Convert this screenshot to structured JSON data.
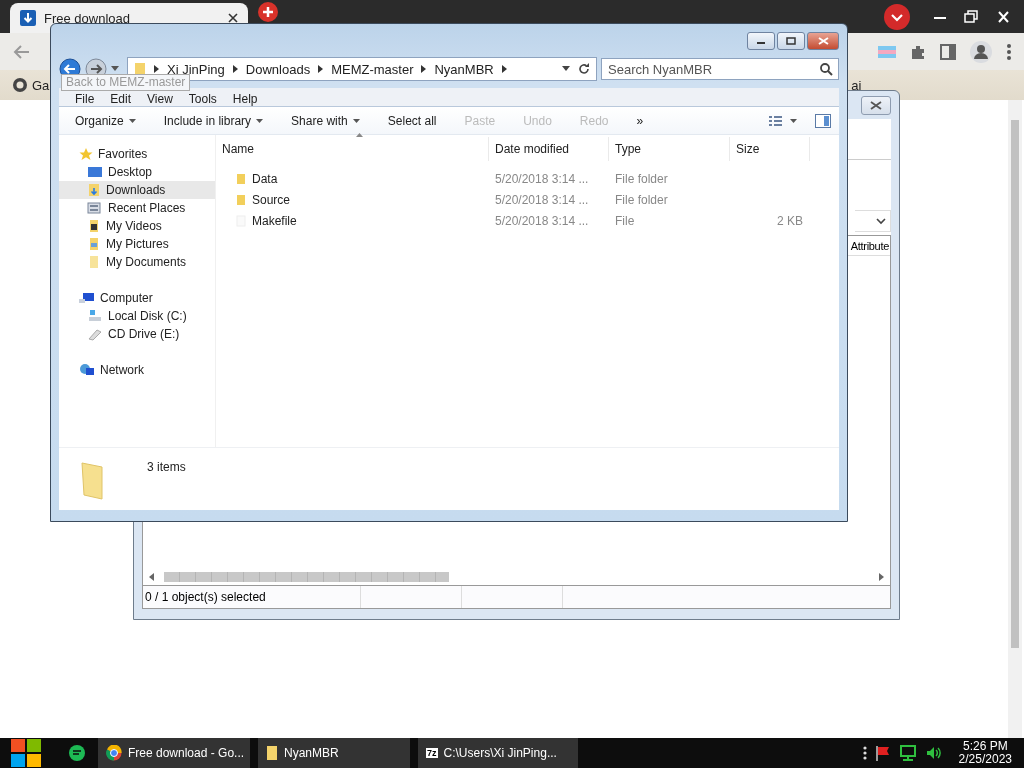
{
  "browser": {
    "tab_title": "Free download",
    "bookmarks": [
      "Ga",
      "ai"
    ]
  },
  "background_window": {
    "column_header": "Attribute",
    "status": "0 / 1 object(s) selected"
  },
  "explorer": {
    "breadcrumb": [
      "Xi JinPing",
      "Downloads",
      "MEMZ-master",
      "NyanMBR"
    ],
    "search": {
      "placeholder": "Search NyanMBR"
    },
    "tooltip": "Back to MEMZ-master",
    "menu": [
      "File",
      "Edit",
      "View",
      "Tools",
      "Help"
    ],
    "toolbar": [
      {
        "label": "Organize",
        "dropdown": true,
        "disabled": false
      },
      {
        "label": "Include in library",
        "dropdown": true,
        "disabled": false
      },
      {
        "label": "Share with",
        "dropdown": true,
        "disabled": false
      },
      {
        "label": "Select all",
        "dropdown": false,
        "disabled": false
      },
      {
        "label": "Paste",
        "dropdown": false,
        "disabled": true
      },
      {
        "label": "Undo",
        "dropdown": false,
        "disabled": true
      },
      {
        "label": "Redo",
        "dropdown": false,
        "disabled": true
      },
      {
        "label": "»",
        "dropdown": false,
        "disabled": false
      }
    ],
    "nav": [
      {
        "label": "Favorites",
        "kind": "star",
        "children": [
          {
            "label": "Desktop",
            "kind": "desktop",
            "selected": false
          },
          {
            "label": "Downloads",
            "kind": "download",
            "selected": true
          },
          {
            "label": "Recent Places",
            "kind": "recent",
            "selected": false
          },
          {
            "label": "My Videos",
            "kind": "video",
            "selected": false
          },
          {
            "label": "My Pictures",
            "kind": "pictures",
            "selected": false
          },
          {
            "label": "My Documents",
            "kind": "documents",
            "selected": false
          }
        ]
      },
      {
        "label": "Computer",
        "kind": "computer",
        "children": [
          {
            "label": "Local Disk (C:)",
            "kind": "disk",
            "selected": false
          },
          {
            "label": "CD Drive (E:)",
            "kind": "cd",
            "selected": false
          }
        ]
      },
      {
        "label": "Network",
        "kind": "network"
      }
    ],
    "columns": [
      "Name",
      "Date modified",
      "Type",
      "Size"
    ],
    "files": [
      {
        "kind": "folder",
        "name": "Data",
        "date": "5/20/2018 3:14 ...",
        "type": "File folder"
      },
      {
        "kind": "folder",
        "name": "Source",
        "date": "5/20/2018 3:14 ...",
        "type": "File folder"
      },
      {
        "kind": "file",
        "name": "Makefile",
        "date": "5/20/2018 3:14 ...",
        "type": "File",
        "size": "2 KB"
      }
    ],
    "status": "3 items"
  },
  "taskbar": {
    "items": [
      {
        "kind": "browser",
        "label": "Free download - Go..."
      },
      {
        "kind": "folder",
        "label": "NyanMBR"
      },
      {
        "kind": "archive",
        "icon_text": "7z",
        "label": "C:\\Users\\Xi JinPing..."
      }
    ],
    "time": "5:26 PM",
    "date": "2/25/2023"
  }
}
